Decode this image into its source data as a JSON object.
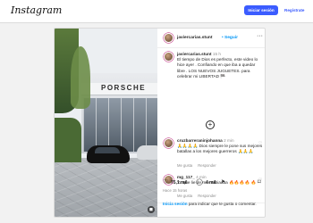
{
  "header": {
    "logo": "Instagram",
    "login_button": "Iniciar sesión",
    "signup_link": "Regístrate"
  },
  "post": {
    "author": "javiercarias.stunt",
    "verified": true,
    "follow_label": "Seguir",
    "more_icon": "more-horizontal-icon",
    "media": {
      "sign_text": "PORSCHE",
      "type": "video"
    },
    "caption": {
      "username": "javiercarias.stunt",
      "time": "15 h",
      "text": "El tiempo de Dios es perfecto, este video lo hice ayer . Confiando en que iba a quedar libre . LOS NUEVOS JUGUETES. para celebrar mi LIBERTAD 🏁"
    },
    "load_more_icon": "plus-circle-icon",
    "comments": [
      {
        "username": "cruzbarreraninjohanna",
        "time": "2 min",
        "text": "🙏🙏🙏🙏 Dios siempre le pone sus mejores batallas a los mejores guerreros 🙏🙏🙏",
        "reply_label": "Responder",
        "likes_label": "Me gusta"
      },
      {
        "username": "mg_117_",
        "time": "4 min",
        "text": "Ya que lie de mas rabiaaaa 🔥🔥🔥🔥 🔥",
        "reply_label": "Responder",
        "likes_label": "Me gusta"
      }
    ],
    "stats": {
      "likes": "75,1 mil",
      "comments": "4 mil",
      "posted_ago": "Hace 15 horas"
    },
    "login_prompt": {
      "link": "Inicia sesión",
      "text": " para indicar que te gusta o comentar."
    }
  }
}
